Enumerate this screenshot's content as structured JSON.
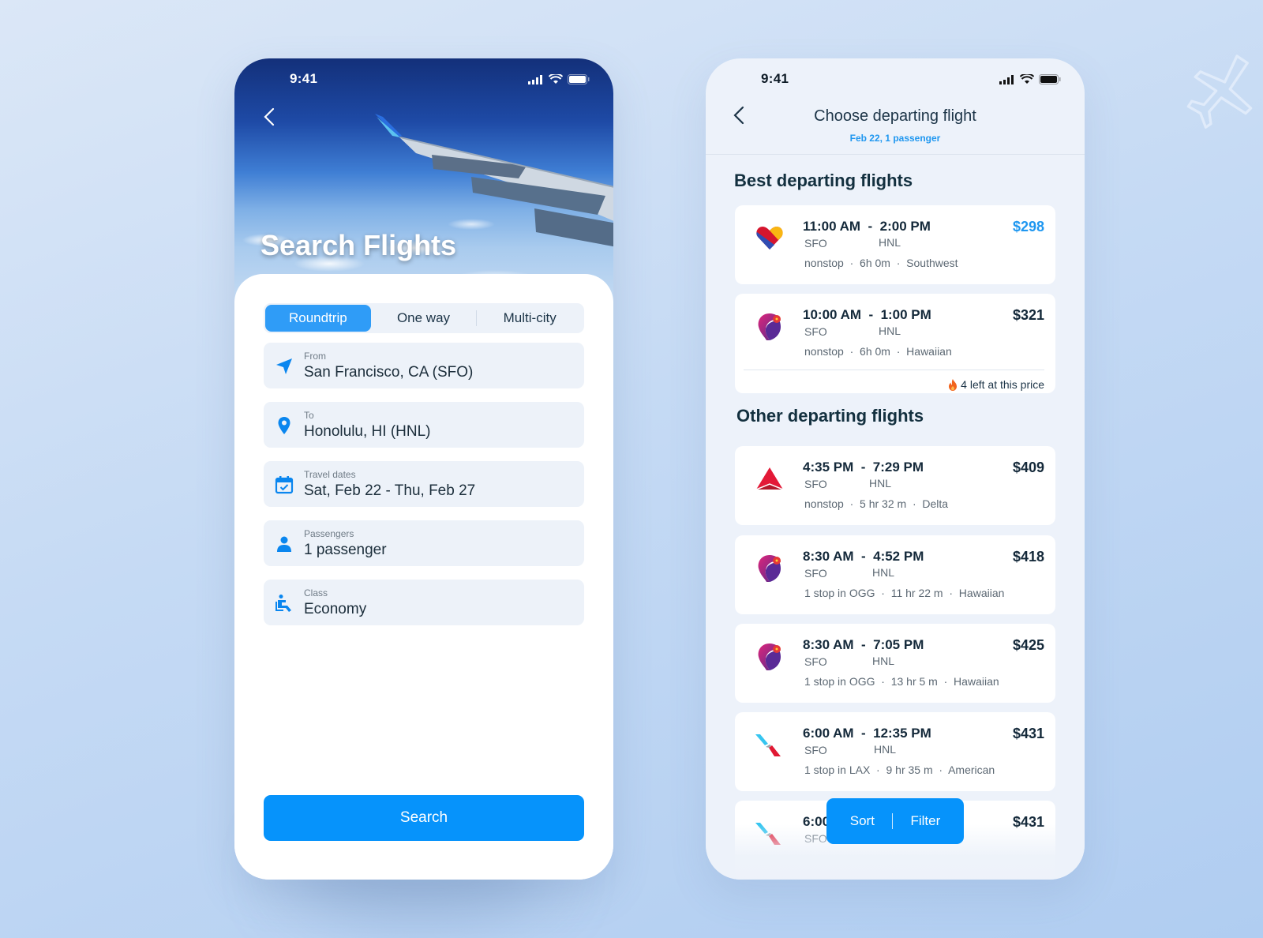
{
  "left_screen": {
    "status_time": "9:41",
    "title": "Search Flights",
    "trip_types": [
      {
        "label": "Roundtrip",
        "active": true
      },
      {
        "label": "One way",
        "active": false
      },
      {
        "label": "Multi-city",
        "active": false
      }
    ],
    "fields": {
      "from": {
        "label": "From",
        "value": "San Francisco, CA (SFO)",
        "icon": "location-arrow-icon"
      },
      "to": {
        "label": "To",
        "value": "Honolulu, HI (HNL)",
        "icon": "map-pin-icon"
      },
      "dates": {
        "label": "Travel dates",
        "value": "Sat, Feb 22  - Thu, Feb 27",
        "icon": "calendar-check-icon"
      },
      "passengers": {
        "label": "Passengers",
        "value": "1 passenger",
        "icon": "person-icon"
      },
      "class": {
        "label": "Class",
        "value": "Economy",
        "icon": "seat-icon"
      }
    },
    "search_label": "Search"
  },
  "right_screen": {
    "status_time": "9:41",
    "title": "Choose departing flight",
    "subtitle": "Feb 22, 1 passenger",
    "best_title": "Best departing flights",
    "other_title": "Other departing flights",
    "best_flights": [
      {
        "times": "11:00 AM  -  2:00 PM",
        "dep": "SFO",
        "arr": "HNL",
        "meta": "nonstop  ·  6h 0m  ·  Southwest",
        "price": "$298",
        "airline": "Southwest"
      },
      {
        "times": "10:00 AM  -  1:00 PM",
        "dep": "SFO",
        "arr": "HNL",
        "meta": "nonstop  ·  6h 0m  ·  Hawaiian",
        "price": "$321",
        "airline": "Hawaiian",
        "deal": "4 left at this price"
      }
    ],
    "other_flights": [
      {
        "times": "4:35 PM  -  7:29 PM",
        "dep": "SFO",
        "arr": "HNL",
        "meta": "nonstop  ·  5 hr 32 m  ·  Delta",
        "price": "$409",
        "airline": "Delta"
      },
      {
        "times": "8:30 AM  -  4:52 PM",
        "dep": "SFO",
        "arr": "HNL",
        "meta": "1 stop in OGG  ·  11 hr 22 m  ·  Hawaiian",
        "price": "$418",
        "airline": "Hawaiian"
      },
      {
        "times": "8:30 AM  -  7:05 PM",
        "dep": "SFO",
        "arr": "HNL",
        "meta": "1 stop in OGG  ·  13 hr 5 m  ·  Hawaiian",
        "price": "$425",
        "airline": "Hawaiian"
      },
      {
        "times": "6:00 AM  -  12:35 PM",
        "dep": "SFO",
        "arr": "HNL",
        "meta": "1 stop in LAX  ·  9 hr 35 m  ·  American",
        "price": "$431",
        "airline": "American"
      },
      {
        "times": "6:00",
        "dep": "SFO",
        "arr": "",
        "meta": "",
        "price": "$431",
        "airline": "American"
      }
    ],
    "sort_label": "Sort",
    "filter_label": "Filter"
  },
  "colors": {
    "accent": "#0693fb",
    "price_highlight": "#1f97f0",
    "text_dark": "#14293a",
    "field_bg": "#edf2f9"
  }
}
